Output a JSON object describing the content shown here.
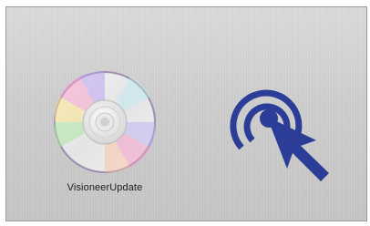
{
  "window": {
    "installer_label": "VisioneerUpdate"
  },
  "icons": {
    "installer": "disc-icon",
    "pointer": "click-pointer-icon"
  },
  "colors": {
    "background_top": "#dcdcdc",
    "background_bottom": "#c6c6c6",
    "pointer_blue": "#2b3d97",
    "label_text": "#222222"
  }
}
